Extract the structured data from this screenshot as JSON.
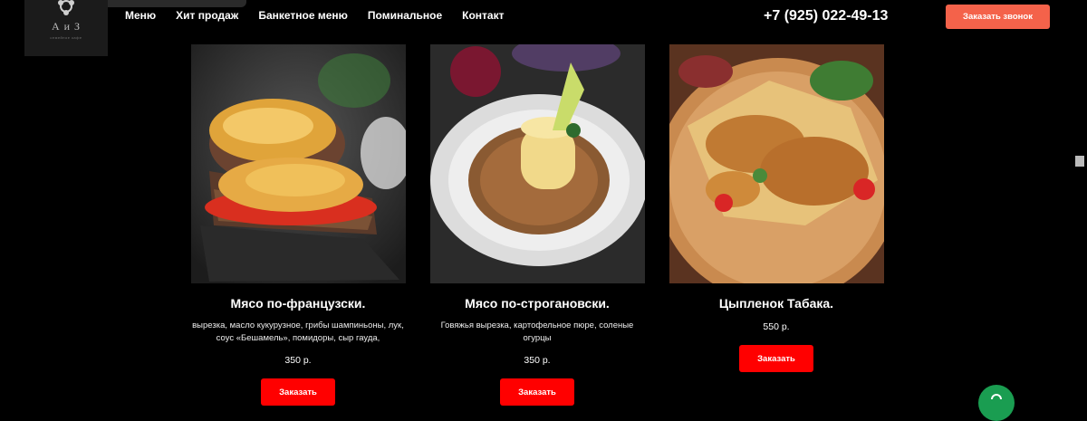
{
  "logo": {
    "text": "А и З",
    "subtitle": "семейное кафе"
  },
  "nav": [
    "Меню",
    "Хит продаж",
    "Банкетное меню",
    "Поминальное",
    "Контакт"
  ],
  "phone": "+7 (925) 022-49-13",
  "call_button": "Заказать звонок",
  "dishes": [
    {
      "name": "Мясо по-французски.",
      "description": "вырезка, масло кукурузное, грибы шампиньоны, лук, соус «Бешамель», помидоры, сыр гауда,",
      "price": "350 р.",
      "order_label": "Заказать"
    },
    {
      "name": "Мясо по-строгановски.",
      "description": "Говяжья вырезка, картофельное пюре, соленые огурцы",
      "price": "350 р.",
      "order_label": "Заказать"
    },
    {
      "name": "Цыпленок Табака.",
      "description": "",
      "price": "550 р.",
      "order_label": "Заказать"
    }
  ],
  "colors": {
    "accent_call": "#f4624a",
    "accent_order": "#ff0000",
    "fab": "#1a9d51"
  },
  "icons": {
    "logo": "flower-ornament-icon",
    "fab": "whatsapp-icon"
  }
}
